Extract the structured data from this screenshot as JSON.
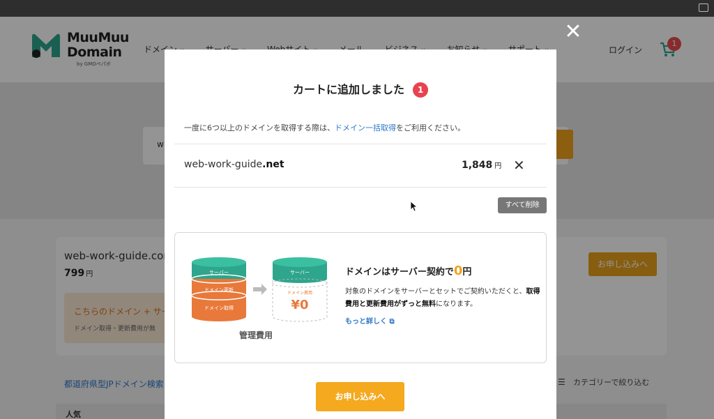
{
  "header": {
    "logo_line1": "MuuMuu",
    "logo_line2": "Domain",
    "logo_sub": "by GMOペパボ",
    "nav": [
      {
        "label": "ドメイン"
      },
      {
        "label": "サーバー"
      },
      {
        "label": "Webサイト"
      },
      {
        "label": "メール"
      },
      {
        "label": "ビジネス"
      },
      {
        "label": "お知らせ"
      },
      {
        "label": "サポート"
      }
    ],
    "login": "ログイン",
    "cart_count": "1"
  },
  "background": {
    "search_prefix": "w",
    "result_domain": "web-work-guide.com",
    "result_price": "799",
    "result_yen": "円",
    "result_button": "お申し込みへ",
    "promo_title": "こちらのドメイン + サー",
    "promo_sub": "ドメイン取得・更新費用が無",
    "jp_link": "都道府県型JPドメイン検索",
    "category_filter": "カテゴリーで絞り込む",
    "popular": "人気"
  },
  "modal": {
    "close": "✕",
    "title": "カートに追加しました",
    "count": "1",
    "notice_pre": "一度に6つ以上のドメインを取得する際は、",
    "notice_link": "ドメイン一括取得",
    "notice_post": "をご利用ください。",
    "item": {
      "name": "web-work-guide",
      "tld": ".net",
      "price": "1,848",
      "yen": "円"
    },
    "clear_all": "すべて削除",
    "promo": {
      "server_label": "サーバー",
      "renew_label": "ドメイン更新",
      "acquire_label": "ドメイン取得",
      "fee_label": "ドメイン費用",
      "fee_value": "¥0",
      "mgmt_label": "管理費用",
      "title_pre": "ドメインはサーバー契約で",
      "title_zero": "0",
      "title_post": "円",
      "desc_pre": "対象のドメインをサーバーとセットでご契約いただくと、",
      "desc_bold": "取得費用と更新費用がずっと無料",
      "desc_post": "になります。",
      "more": "もっと詳しく"
    },
    "apply": "お申し込みへ"
  },
  "colors": {
    "accent": "#f4a91f",
    "badge": "#e8434f",
    "link": "#2d78c8",
    "teal": "#2ea58d",
    "orange": "#e8793a"
  }
}
